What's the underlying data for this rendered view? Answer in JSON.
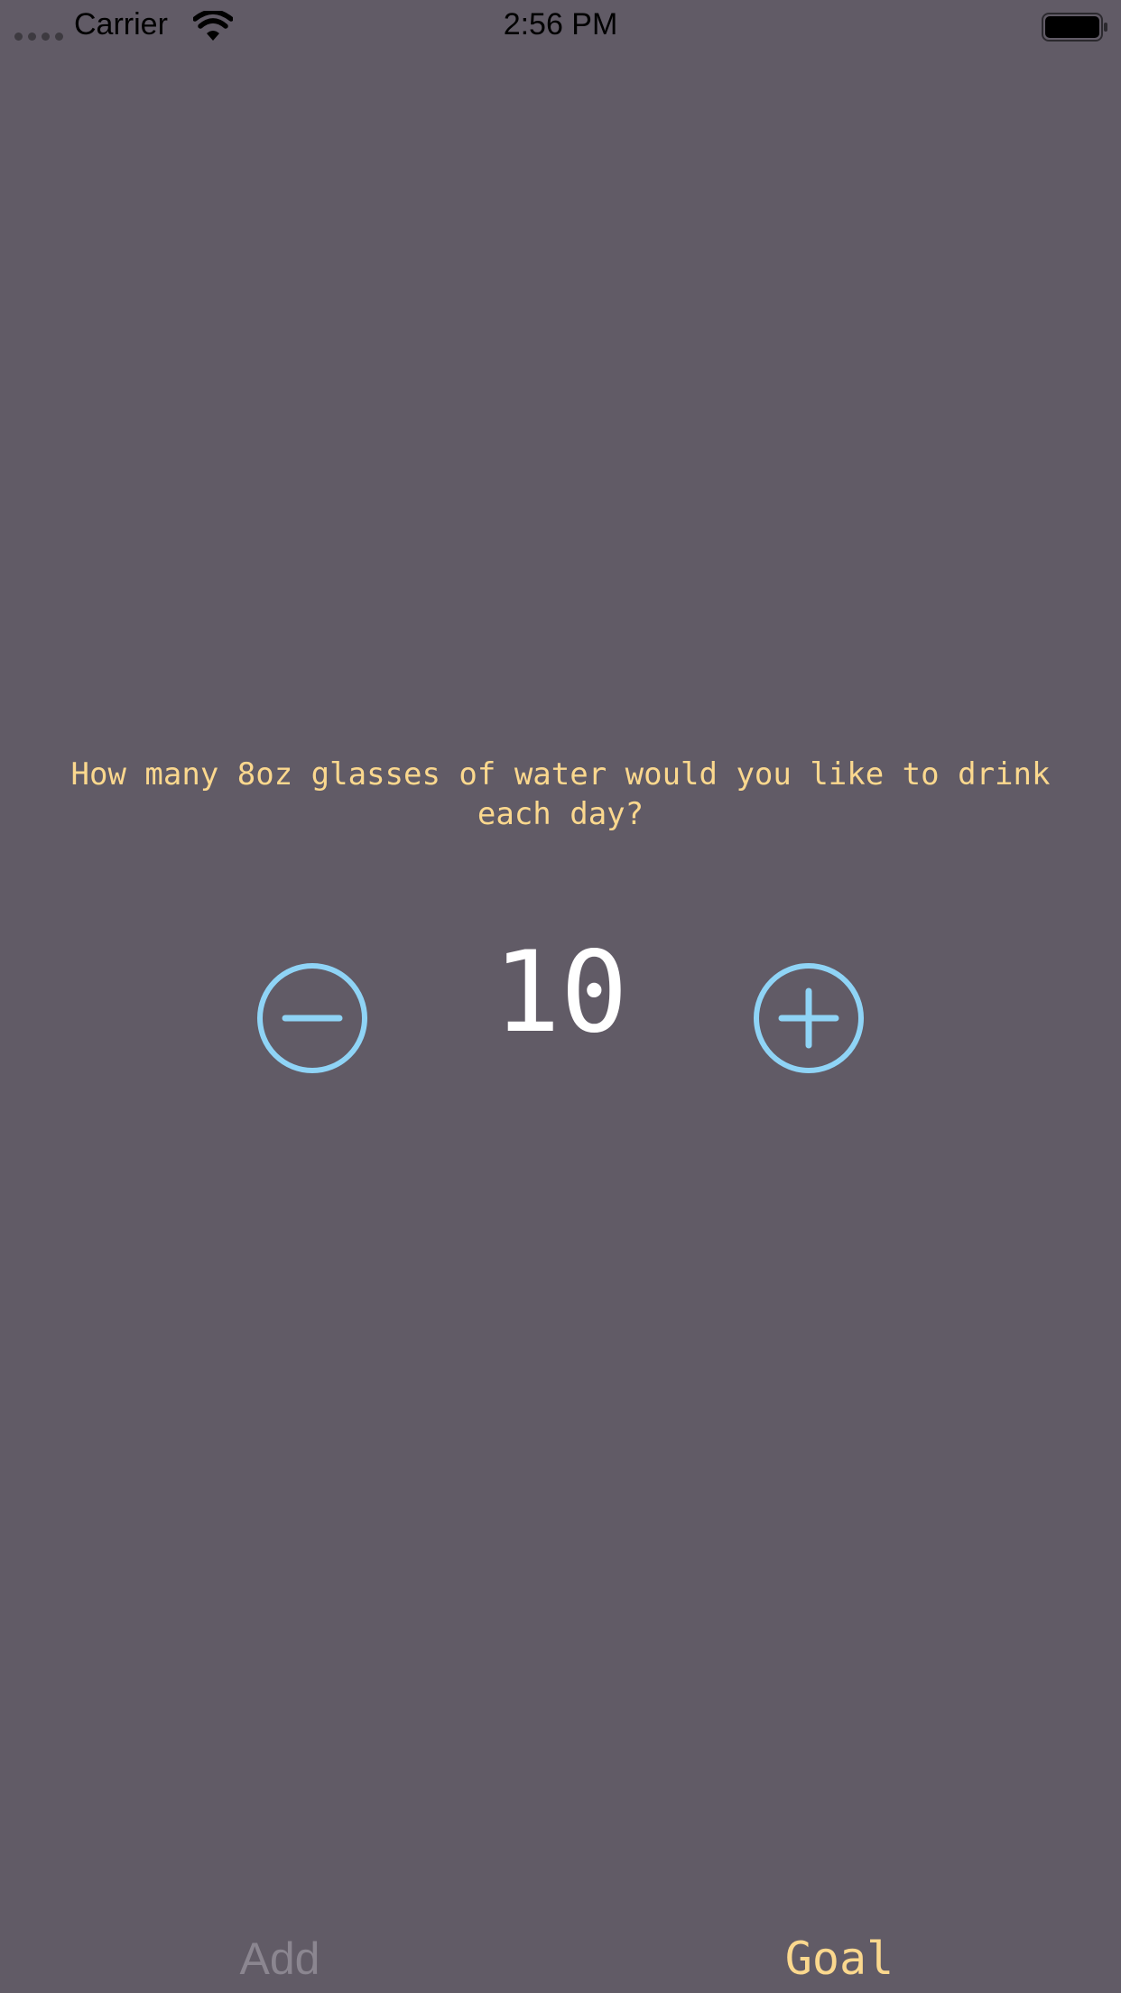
{
  "status_bar": {
    "carrier": "Carrier",
    "time": "2:56 PM"
  },
  "goal_screen": {
    "question": "How many 8oz glasses of water would you like to drink each day?",
    "count": "10",
    "decrement_icon": "minus-circle-icon",
    "increment_icon": "plus-circle-icon"
  },
  "tab_bar": {
    "tabs": [
      {
        "label": "Add",
        "active": false
      },
      {
        "label": "Goal",
        "active": true
      }
    ]
  },
  "colors": {
    "background": "#615b66",
    "accent_text": "#fbd88e",
    "button": "#8fd4f6",
    "inactive_tab": "#8b8690",
    "count": "#ffffff"
  }
}
